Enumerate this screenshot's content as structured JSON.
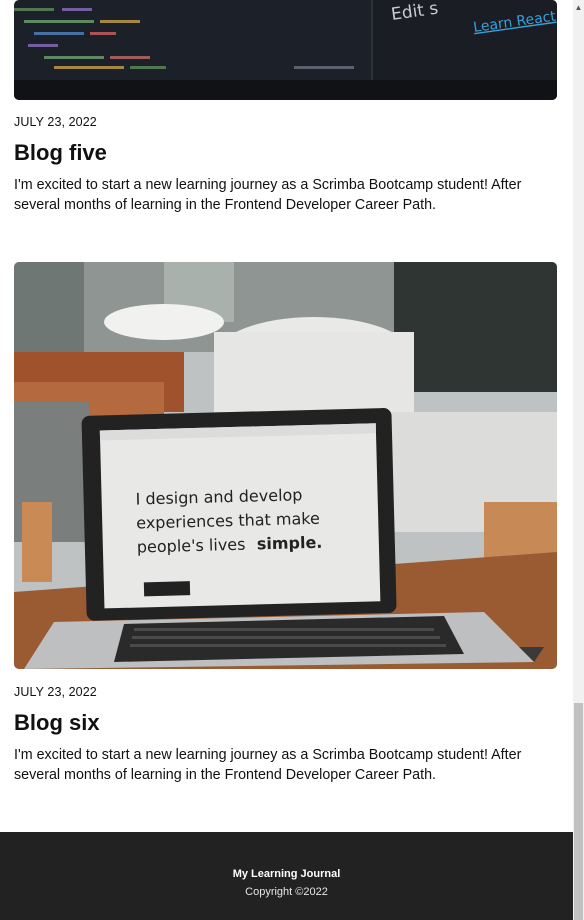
{
  "posts": [
    {
      "date": "JULY 23, 2022",
      "title": "Blog five",
      "body": "I'm excited to start a new learning journey as a Scrimba Bootcamp student! After several months of learning in the Frontend Developer Career Path.",
      "image": {
        "overlay_text": "Edit s",
        "link_text": "Learn React"
      }
    },
    {
      "date": "JULY 23, 2022",
      "title": "Blog six",
      "body": "I'm excited to start a new learning journey as a Scrimba Bootcamp student! After several months of learning in the Frontend Developer Career Path.",
      "image": {
        "screen_line1": "I design and develop",
        "screen_line2": "experiences that make",
        "screen_line3": "people's lives",
        "screen_emphasis": "simple."
      }
    }
  ],
  "footer": {
    "title": "My Learning Journal",
    "copyright": "Copyright ©2022"
  },
  "colors": {
    "footer_bg": "#222222",
    "code_bg": "#1b1f27",
    "link_blue": "#3aa0d8"
  },
  "icons": {
    "scroll_up": "▲"
  }
}
